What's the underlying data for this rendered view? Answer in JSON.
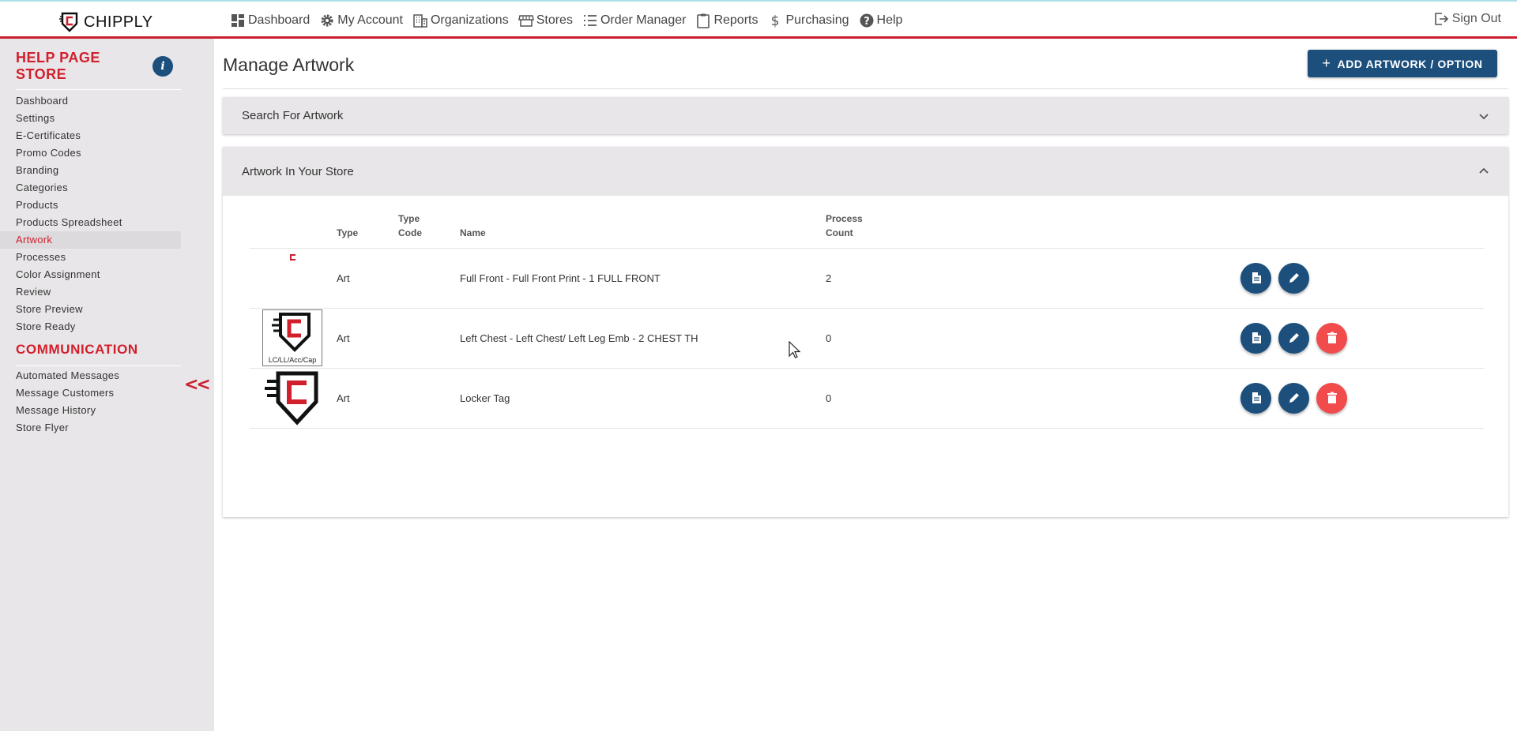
{
  "brand": {
    "name": "CHIPPLY",
    "accent": "#c8202f",
    "primary": "#1c4f7c"
  },
  "nav": [
    {
      "label": "Dashboard",
      "icon": "dashboard-icon"
    },
    {
      "label": "My Account",
      "icon": "gear-icon"
    },
    {
      "label": "Organizations",
      "icon": "building-icon"
    },
    {
      "label": "Stores",
      "icon": "store-icon"
    },
    {
      "label": "Order Manager",
      "icon": "list-icon"
    },
    {
      "label": "Reports",
      "icon": "clipboard-icon"
    },
    {
      "label": "Purchasing",
      "icon": "dollar-icon"
    },
    {
      "label": "Help",
      "icon": "help-icon"
    }
  ],
  "signout": "Sign Out",
  "sidebar": {
    "store_title": "HELP PAGE STORE",
    "info": "i",
    "items": [
      "Dashboard",
      "Settings",
      "E-Certificates",
      "Promo Codes",
      "Branding",
      "Categories",
      "Products",
      "Products Spreadsheet",
      "Artwork",
      "Processes",
      "Color Assignment",
      "Review",
      "Store Preview",
      "Store Ready"
    ],
    "active": "Artwork",
    "communication_title": "COMMUNICATION",
    "communication_items": [
      "Automated Messages",
      "Message Customers",
      "Message History",
      "Store Flyer"
    ],
    "collapse": "<<"
  },
  "main": {
    "title": "Manage Artwork",
    "add_button": "ADD ARTWORK / OPTION",
    "search_panel": "Search For Artwork",
    "artwork_panel": "Artwork In Your Store",
    "columns": {
      "type": "Type",
      "type_code_1": "Type",
      "type_code_2": "Code",
      "name": "Name",
      "process_1": "Process",
      "process_2": "Count"
    },
    "rows": [
      {
        "type": "Art",
        "type_code": "",
        "name": "Full Front - Full Front Print - 1 FULL FRONT",
        "process_count": "2",
        "thumb_caption": "",
        "can_delete": false
      },
      {
        "type": "Art",
        "type_code": "",
        "name": "Left Chest - Left Chest/ Left Leg Emb - 2 CHEST TH",
        "process_count": "0",
        "thumb_caption": "LC/LL/Acc/Cap",
        "can_delete": true
      },
      {
        "type": "Art",
        "type_code": "",
        "name": "Locker Tag",
        "process_count": "0",
        "thumb_caption": "",
        "can_delete": true
      }
    ]
  }
}
